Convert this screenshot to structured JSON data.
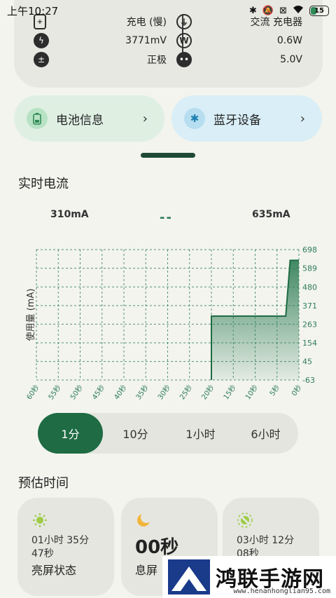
{
  "status_bar": {
    "time": "上午10:27",
    "battery": "15",
    "icons": [
      "bluetooth-icon",
      "mute-icon",
      "sim-off-icon",
      "wifi-icon",
      "battery-icon"
    ]
  },
  "top_card": {
    "left": [
      {
        "icon": "battery-plus-icon",
        "value": "充电 (慢)"
      },
      {
        "icon": "bolt-icon",
        "value": "3771mV"
      },
      {
        "icon": "polarity-icon",
        "value": "正极"
      }
    ],
    "right": [
      {
        "icon": "plug-icon",
        "value": "交流 充电器"
      },
      {
        "icon": "watt-icon",
        "icon_text": "W",
        "value": "0.6W"
      },
      {
        "icon": "socket-icon",
        "value": "5.0V"
      }
    ]
  },
  "buttons": {
    "battery_info": {
      "label": "电池信息",
      "chevron": "›",
      "bg": "#dff0e3",
      "icon_bg": "#b7e2c4"
    },
    "bluetooth": {
      "label": "蓝牙设备",
      "chevron": "›",
      "bg": "#d9eef6",
      "icon_bg": "#b6def0"
    }
  },
  "realtime": {
    "title": "实时电流",
    "min_label": "310mA",
    "status": "--",
    "max_label": "635mA"
  },
  "chart_data": {
    "type": "area",
    "ylabel": "使用量 (mA)",
    "x_ticks": [
      "60秒",
      "55秒",
      "50秒",
      "45秒",
      "40秒",
      "35秒",
      "30秒",
      "25秒",
      "20秒",
      "15秒",
      "10秒",
      "5秒",
      "0秒"
    ],
    "y_ticks": [
      698,
      589,
      480,
      371,
      263,
      154,
      45,
      -63
    ],
    "ylim": [
      -63,
      698
    ],
    "xlim": [
      60,
      0
    ],
    "grid": true,
    "color": "#2e7d55",
    "points": [
      [
        20,
        310
      ],
      [
        3,
        310
      ],
      [
        2,
        635
      ],
      [
        0,
        635
      ]
    ]
  },
  "ranges": {
    "items": [
      "1分",
      "10分",
      "1小时",
      "6小时"
    ],
    "active": 0
  },
  "estimate": {
    "title": "预估时间",
    "cards": [
      {
        "icon": "sun-icon",
        "line1": "01小时 35分",
        "line2": "47秒",
        "label": "亮屏状态"
      },
      {
        "icon": "moon-icon",
        "big": "00秒",
        "label": "息屏"
      },
      {
        "icon": "sun-cross-icon",
        "line1": "03小时 12分",
        "line2": "08秒",
        "label": ""
      }
    ]
  },
  "watermark": {
    "text": "鸿联手游网",
    "url": "www.henanhonglian95.com"
  }
}
